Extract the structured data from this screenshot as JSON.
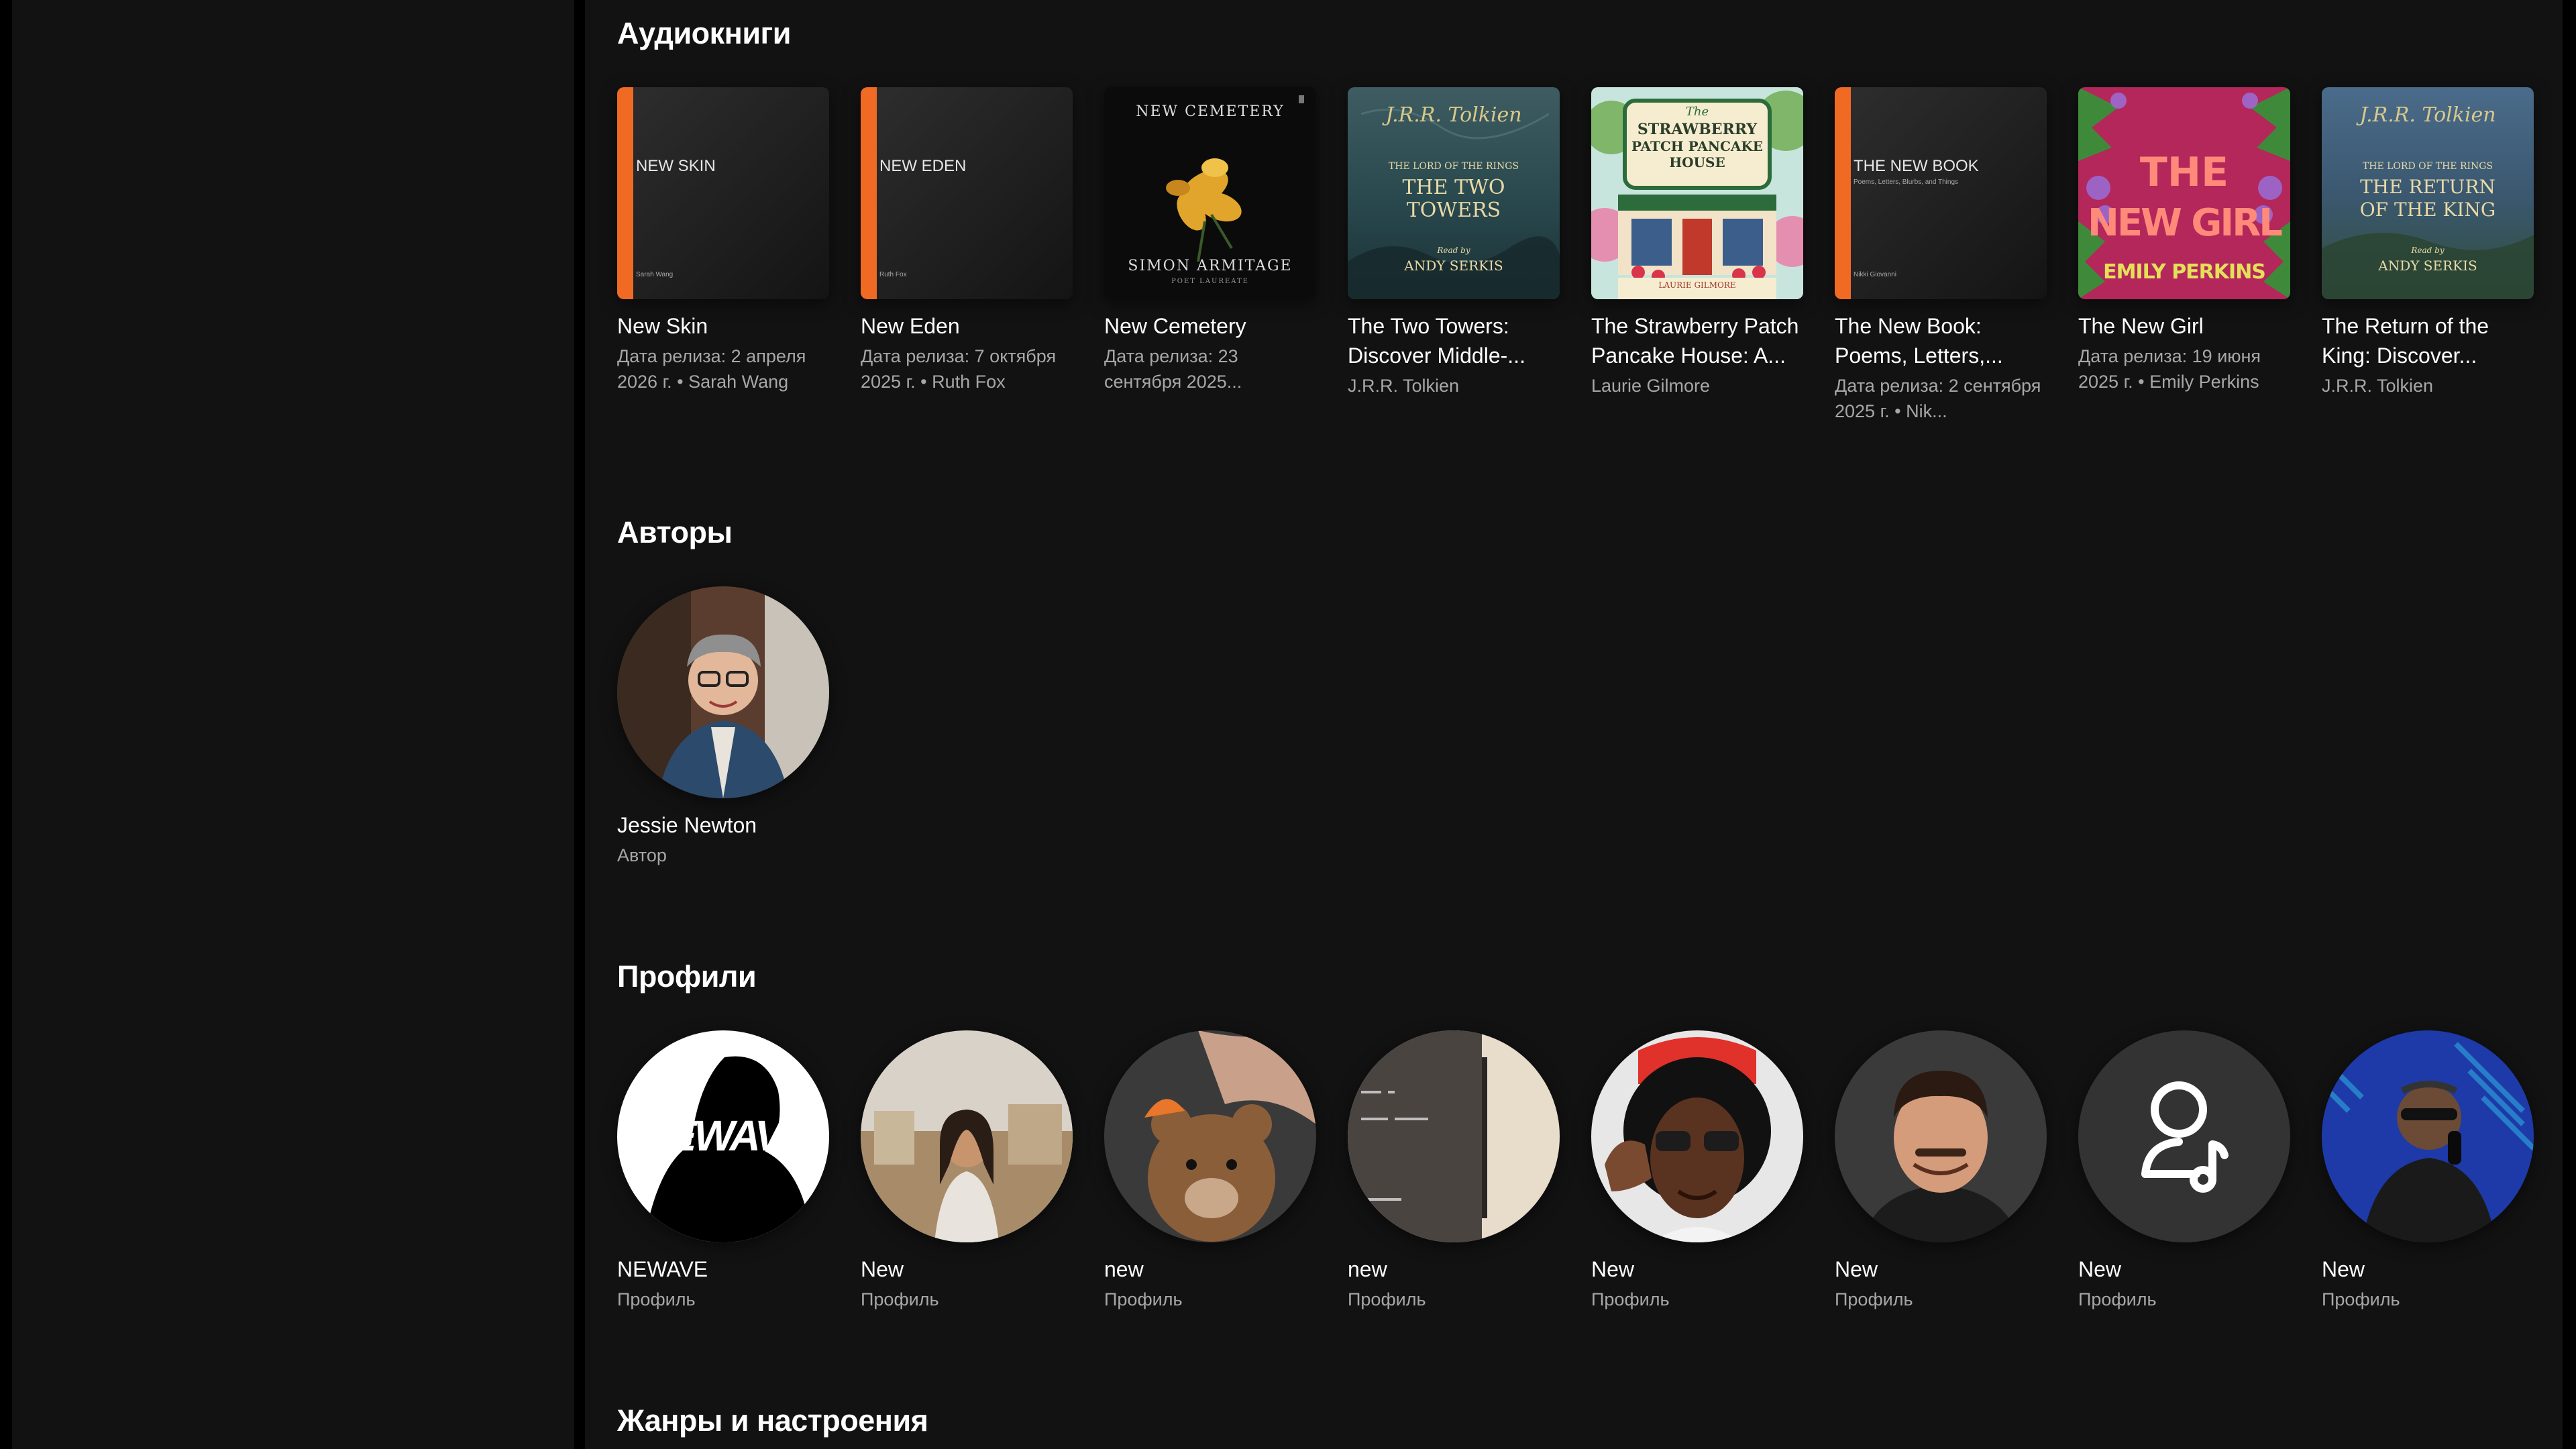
{
  "sections": {
    "audiobooks": {
      "title": "Аудиокниги",
      "items": [
        {
          "title": "New Skin",
          "subtitle": "Дата релиза: 2 апреля 2026 г. • Sarah Wang",
          "cover_title": "NEW SKIN",
          "cover_author": "Sarah Wang"
        },
        {
          "title": "New Eden",
          "subtitle": "Дата релиза: 7 октября 2025 г. • Ruth Fox",
          "cover_title": "NEW EDEN",
          "cover_author": "Ruth Fox"
        },
        {
          "title": "New Cemetery",
          "subtitle": "Дата релиза: 23 сентября 2025...",
          "cover_title": "NEW CEMETERY",
          "cover_author": "SIMON ARMITAGE",
          "cover_note": "POET LAUREATE"
        },
        {
          "title": "The Two Towers: Discover Middle-...",
          "subtitle": "J.R.R. Tolkien",
          "cover_sig": "J.R.R. Tolkien",
          "cover_series": "THE LORD OF THE RINGS",
          "cover_title_1": "THE TWO",
          "cover_title_2": "TOWERS",
          "cover_readby": "Read by",
          "cover_reader": "ANDY SERKIS"
        },
        {
          "title": "The Strawberry Patch Pancake House: A...",
          "subtitle": "Laurie Gilmore",
          "cover_the": "The",
          "cover_title_1": "STRAWBERRY",
          "cover_title_2": "PATCH PANCAKE",
          "cover_title_3": "HOUSE",
          "cover_author": "LAURIE GILMORE"
        },
        {
          "title": "The New Book: Poems, Letters,...",
          "subtitle": "Дата релиза: 2 сентября 2025 г. • Nik...",
          "cover_title": "THE NEW BOOK",
          "cover_subtitle": "Poems, Letters, Blurbs, and Things",
          "cover_author": "Nikki Giovanni"
        },
        {
          "title": "The New Girl",
          "subtitle": "Дата релиза: 19 июня 2025 г. • Emily Perkins",
          "cover_title_1": "THE",
          "cover_title_2": "NEW GIRL",
          "cover_author": "EMILY PERKINS"
        },
        {
          "title": "The Return of the King: Discover...",
          "subtitle": "J.R.R. Tolkien",
          "cover_sig": "J.R.R. Tolkien",
          "cover_series": "THE LORD OF THE RINGS",
          "cover_title_1": "THE RETURN",
          "cover_title_2": "OF THE KING",
          "cover_readby": "Read by",
          "cover_reader": "ANDY SERKIS"
        }
      ]
    },
    "authors": {
      "title": "Авторы",
      "items": [
        {
          "title": "Jessie Newton",
          "subtitle": "Автор"
        }
      ]
    },
    "profiles": {
      "title": "Профили",
      "items": [
        {
          "title": "NEWAVE",
          "subtitle": "Профиль",
          "avatar_text": "NEWAVE"
        },
        {
          "title": "New",
          "subtitle": "Профиль"
        },
        {
          "title": "new",
          "subtitle": "Профиль"
        },
        {
          "title": "new",
          "subtitle": "Профиль"
        },
        {
          "title": "New",
          "subtitle": "Профиль"
        },
        {
          "title": "New",
          "subtitle": "Профиль"
        },
        {
          "title": "New",
          "subtitle": "Профиль",
          "avatar_icon": "user-music-icon"
        },
        {
          "title": "New",
          "subtitle": "Профиль"
        }
      ]
    },
    "genres": {
      "title": "Жанры и настроения"
    }
  },
  "colors": {
    "background": "#121212",
    "page": "#000000",
    "text_primary": "#ffffff",
    "text_secondary": "#a7a7a7",
    "accent_orange": "#f06a24"
  }
}
